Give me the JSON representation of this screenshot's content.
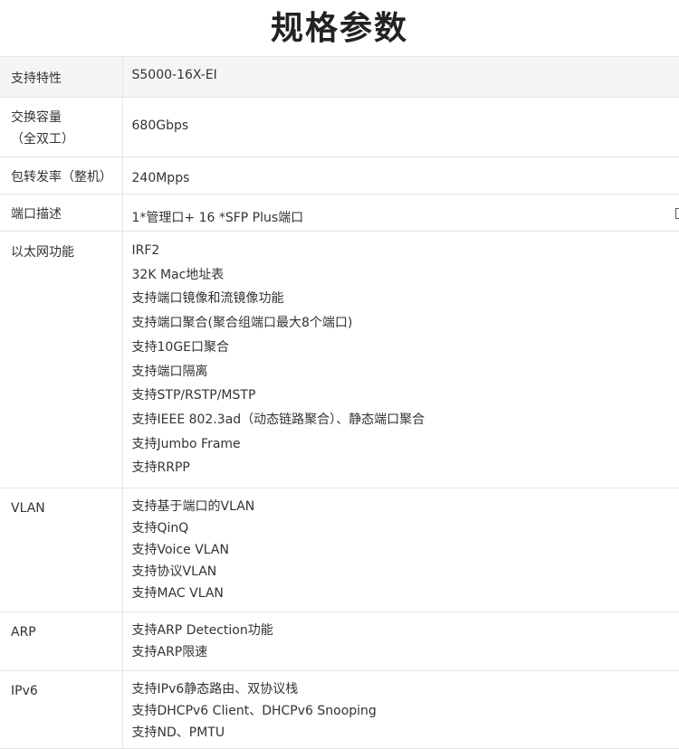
{
  "title": "规格参数",
  "rows": {
    "header": {
      "label": "支持特性",
      "lines": [
        "S5000-16X-EI"
      ]
    },
    "capacity": {
      "label_lines": [
        "交换容量",
        "（全双工）"
      ],
      "lines": [
        "680Gbps"
      ]
    },
    "pps": {
      "label": "包转发率（整机）",
      "lines": [
        "240Mpps"
      ]
    },
    "port": {
      "label": "端口描述",
      "lines": [
        "1*管理口+ 16 *SFP Plus端口"
      ]
    },
    "ethernet": {
      "label": "以太网功能",
      "lines": [
        "IRF2",
        "32K Mac地址表",
        "支持端口镜像和流镜像功能",
        "支持端口聚合(聚合组端口最大8个端口)",
        "支持10GE口聚合",
        "支持端口隔离",
        "支持STP/RSTP/MSTP",
        "支持IEEE 802.3ad（动态链路聚合）、静态端口聚合",
        "支持Jumbo Frame",
        "支持RRPP"
      ]
    },
    "vlan": {
      "label": "VLAN",
      "lines": [
        "支持基于端口的VLAN",
        "支持QinQ",
        "支持Voice VLAN",
        "支持协议VLAN",
        "支持MAC VLAN"
      ]
    },
    "arp": {
      "label": "ARP",
      "lines": [
        "支持ARP Detection功能",
        "支持ARP限速"
      ]
    },
    "ipv6": {
      "label": "IPv6",
      "lines": [
        "支持IPv6静态路由、双协议栈",
        "支持DHCPv6 Client、DHCPv6 Snooping",
        "支持ND、PMTU"
      ]
    }
  }
}
